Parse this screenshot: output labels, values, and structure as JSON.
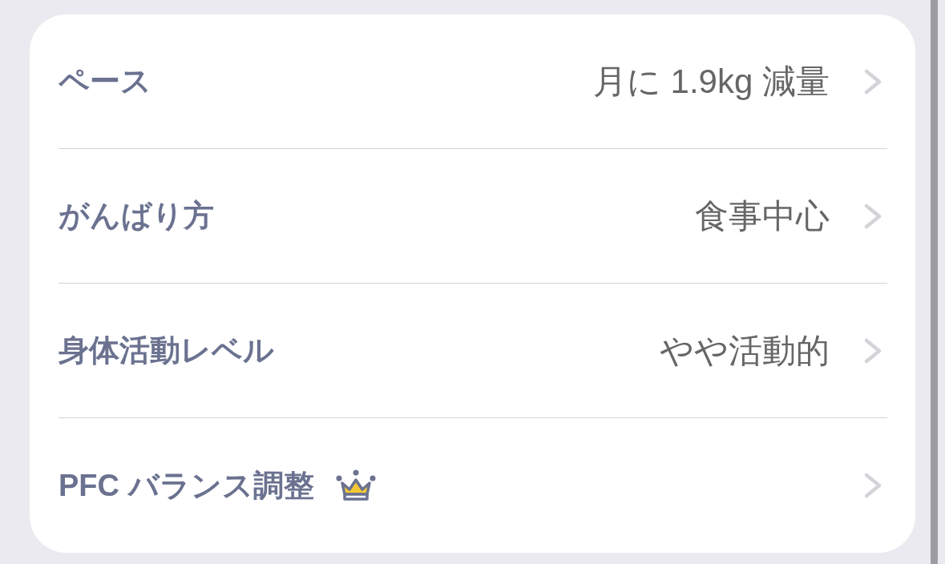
{
  "settings": [
    {
      "label": "ペース",
      "value": "月に 1.9kg 減量",
      "premium": false
    },
    {
      "label": "がんばり方",
      "value": "食事中心",
      "premium": false
    },
    {
      "label": "身体活動レベル",
      "value": "やや活動的",
      "premium": false
    },
    {
      "label": "PFC バランス調整",
      "premium": true
    }
  ]
}
